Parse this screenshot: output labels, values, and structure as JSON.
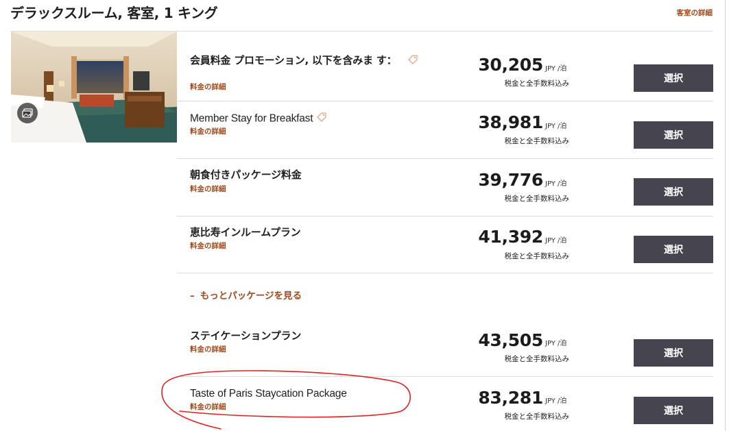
{
  "header": {
    "title": "デラックスルーム, 客室, 1 キング",
    "room_details_link": "客室の詳細"
  },
  "room_image": {
    "alt": "Deluxe room with king bed",
    "gallery_icon": "gallery-icon"
  },
  "rates": [
    {
      "name": "会員料金 プロモーション, 以下を含みま す：",
      "details_link": "料金の詳細",
      "has_tag": true,
      "price": "30,205",
      "unit": "JPY /泊",
      "tax_note": "税金と全手数料込み",
      "button": "選択"
    },
    {
      "name": "Member Stay for Breakfast",
      "details_link": "料金の詳細",
      "has_tag": true,
      "price": "38,981",
      "unit": "JPY /泊",
      "tax_note": "税金と全手数料込み",
      "button": "選択"
    },
    {
      "name": "朝食付きパッケージ料金",
      "details_link": "料金の詳細",
      "has_tag": false,
      "price": "39,776",
      "unit": "JPY /泊",
      "tax_note": "税金と全手数料込み",
      "button": "選択"
    },
    {
      "name": "恵比寿インルームプラン",
      "details_link": "料金の詳細",
      "has_tag": false,
      "price": "41,392",
      "unit": "JPY /泊",
      "tax_note": "税金と全手数料込み",
      "button": "選択"
    },
    {
      "name": "ステイケーションプラン",
      "details_link": "料金の詳細",
      "has_tag": false,
      "price": "43,505",
      "unit": "JPY /泊",
      "tax_note": "税金と全手数料込み",
      "button": "選択"
    },
    {
      "name": "Taste of Paris Staycation Package",
      "details_link": "料金の詳細",
      "has_tag": false,
      "price": "83,281",
      "unit": "JPY /泊",
      "tax_note": "税金と全手数料込み",
      "button": "選択"
    }
  ],
  "more_packages": {
    "icon": "–",
    "label": "もっとパッケージを見る"
  },
  "colors": {
    "accent": "#a04a1c",
    "button_bg": "#46444f",
    "annotation": "#e02020"
  }
}
